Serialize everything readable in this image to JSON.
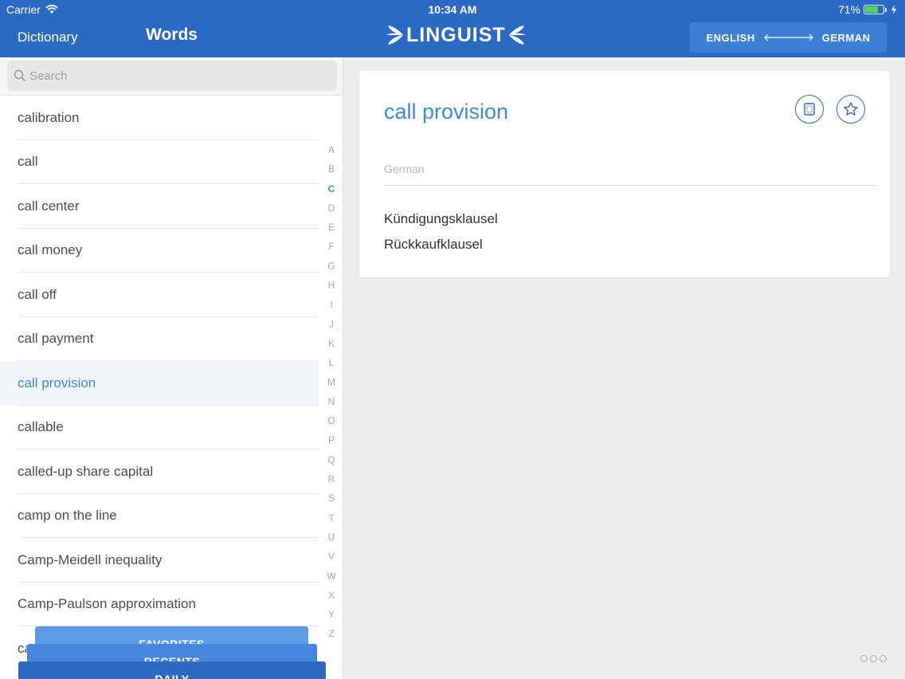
{
  "status_bar": {
    "carrier": "Carrier",
    "time": "10:34 AM",
    "battery": "71%"
  },
  "nav": {
    "dictionary": "Dictionary",
    "words": "Words"
  },
  "logo": {
    "text": "LINGUIST"
  },
  "language_switch": {
    "from": "ENGLISH",
    "to": "GERMAN"
  },
  "search": {
    "placeholder": "Search"
  },
  "words": [
    "calibration",
    "call",
    "call center",
    "call money",
    "call off",
    "call payment",
    "call provision",
    "callable",
    "called-up share capital",
    "camp on the line",
    "Camp-Meidell inequality",
    "Camp-Paulson approximation",
    "ca"
  ],
  "selected_word_index": 6,
  "alphabet_index": [
    "A",
    "B",
    "C",
    "D",
    "E",
    "F",
    "G",
    "H",
    "I",
    "J",
    "K",
    "L",
    "M",
    "N",
    "O",
    "P",
    "Q",
    "R",
    "S",
    "T",
    "U",
    "V",
    "W",
    "X",
    "Y",
    "Z"
  ],
  "active_letter": "C",
  "tabs": {
    "favorites": "FAVORITES",
    "recents": "RECENTS",
    "daily": "DAILY"
  },
  "entry": {
    "title": "call provision",
    "language": "German",
    "translations": [
      "Kündigungsklausel",
      "Rückkaufklausel"
    ]
  },
  "icons": {
    "flashcard": "flashcard-icon",
    "star": "star-icon",
    "more": "more-icon"
  },
  "colors": {
    "header": "#2b6ac4",
    "accent": "#3e8ad6",
    "battery": "#4cd964"
  }
}
